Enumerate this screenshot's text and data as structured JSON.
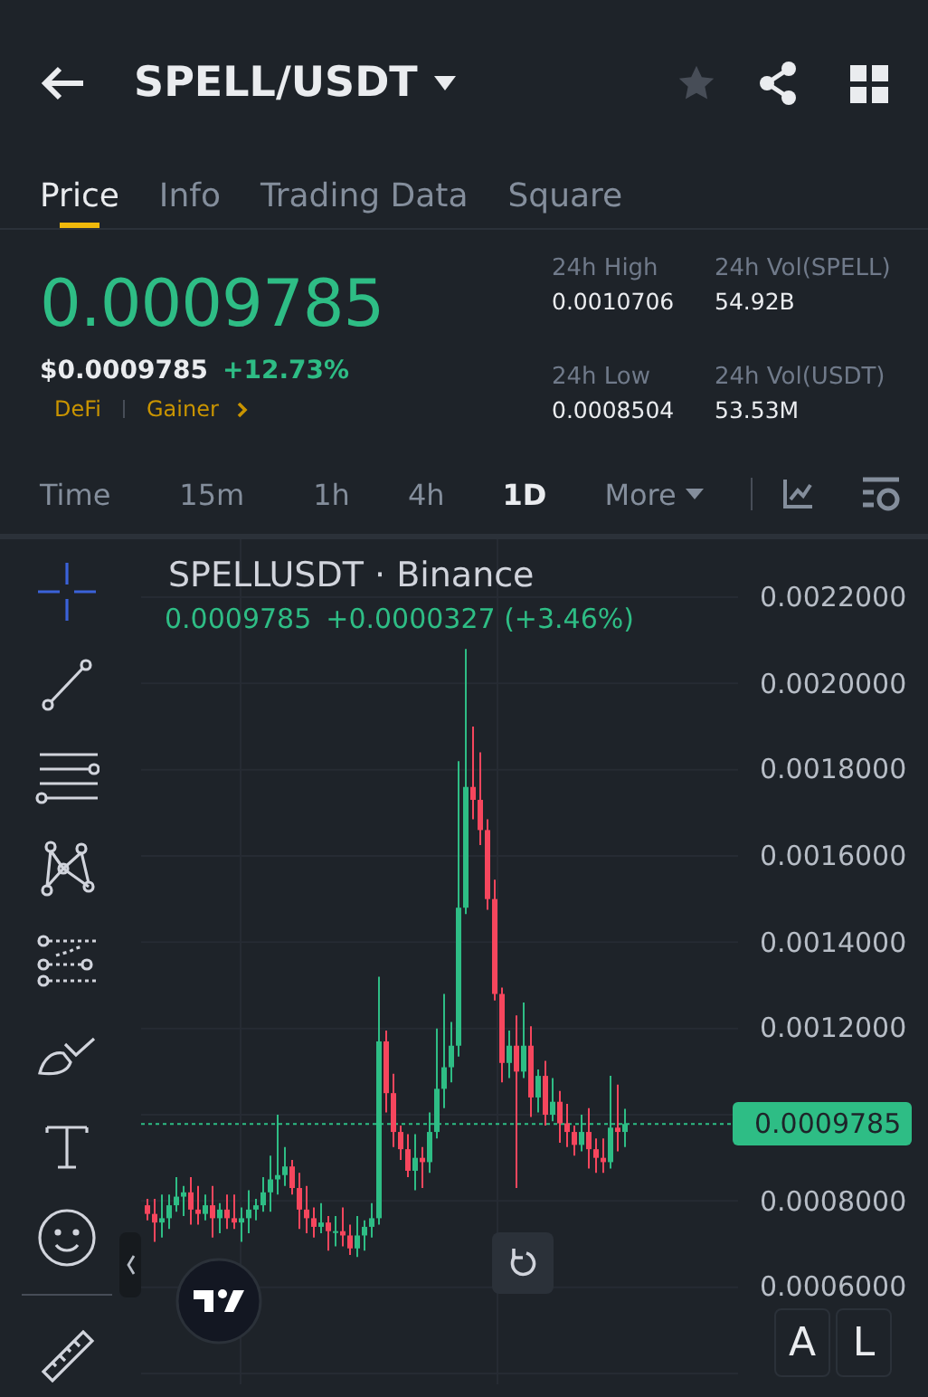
{
  "header": {
    "title": "SPELL/USDT",
    "favorite": false
  },
  "tabs": [
    {
      "label": "Price",
      "selected": true
    },
    {
      "label": "Info",
      "selected": false
    },
    {
      "label": "Trading Data",
      "selected": false
    },
    {
      "label": "Square",
      "selected": false
    }
  ],
  "price": {
    "last": "0.0009785",
    "fiat": "$0.0009785",
    "change": "+12.73%",
    "tags": [
      "DeFi",
      "Gainer"
    ]
  },
  "stats": [
    {
      "label": "24h High",
      "value": "0.0010706"
    },
    {
      "label": "24h Vol(SPELL)",
      "value": "54.92B"
    },
    {
      "label": "24h Low",
      "value": "0.0008504"
    },
    {
      "label": "24h Vol(USDT)",
      "value": "53.53M"
    }
  ],
  "intervals": [
    {
      "label": "Time",
      "selected": false,
      "kind": "plain"
    },
    {
      "label": "15m",
      "selected": false,
      "kind": "plain"
    },
    {
      "label": "1h",
      "selected": false,
      "kind": "plain"
    },
    {
      "label": "4h",
      "selected": false,
      "kind": "plain"
    },
    {
      "label": "1D",
      "selected": true,
      "kind": "plain"
    },
    {
      "label": "More",
      "selected": false,
      "kind": "menu"
    }
  ],
  "chart": {
    "symbol": "SPELLUSDT · Binance",
    "last": "0.0009785",
    "change": "+0.0000327 (+3.46%)",
    "buttons": [
      "A",
      "L"
    ],
    "chart_data": {
      "type": "candlestick",
      "ylim": [
        0.0004,
        0.0022
      ],
      "grid": true,
      "ref_lines": [
        {
          "axis": "y",
          "value": 0.0009785,
          "label": "0.0009785",
          "color": "#2ebd85"
        }
      ],
      "yticks": [
        {
          "value": 0.0022,
          "label": "0.0022000"
        },
        {
          "value": 0.002,
          "label": "0.0020000"
        },
        {
          "value": 0.0018,
          "label": "0.0018000"
        },
        {
          "value": 0.0016,
          "label": "0.0016000"
        },
        {
          "value": 0.0014,
          "label": "0.0014000"
        },
        {
          "value": 0.0012,
          "label": "0.0012000"
        },
        {
          "value": 0.0008,
          "label": "0.0008000"
        },
        {
          "value": 0.0006,
          "label": "0.0006000"
        }
      ],
      "ohlc": [
        [
          0.00079,
          0.000805,
          0.000755,
          0.00077
        ],
        [
          0.00077,
          0.000805,
          0.000705,
          0.00075
        ],
        [
          0.00075,
          0.000815,
          0.000715,
          0.00076
        ],
        [
          0.00076,
          0.000815,
          0.000735,
          0.00079
        ],
        [
          0.00079,
          0.000855,
          0.000775,
          0.00081
        ],
        [
          0.00081,
          0.000835,
          0.000765,
          0.00082
        ],
        [
          0.00082,
          0.000855,
          0.000745,
          0.00078
        ],
        [
          0.00078,
          0.000835,
          0.000745,
          0.00077
        ],
        [
          0.00077,
          0.000815,
          0.000755,
          0.00079
        ],
        [
          0.00079,
          0.000835,
          0.000715,
          0.00076
        ],
        [
          0.00076,
          0.000795,
          0.000725,
          0.00078
        ],
        [
          0.00078,
          0.000815,
          0.000735,
          0.00076
        ],
        [
          0.00076,
          0.000815,
          0.000735,
          0.00075
        ],
        [
          0.00075,
          0.000785,
          0.000705,
          0.00076
        ],
        [
          0.00076,
          0.000825,
          0.000725,
          0.00078
        ],
        [
          0.00078,
          0.000805,
          0.000755,
          0.00079
        ],
        [
          0.00079,
          0.000855,
          0.000775,
          0.00082
        ],
        [
          0.00082,
          0.000905,
          0.000775,
          0.00085
        ],
        [
          0.00085,
          0.001,
          0.000815,
          0.00086
        ],
        [
          0.00086,
          0.000925,
          0.000835,
          0.00088
        ],
        [
          0.00088,
          0.000895,
          0.000815,
          0.00083
        ],
        [
          0.00083,
          0.000865,
          0.000735,
          0.00078
        ],
        [
          0.00078,
          0.000835,
          0.000725,
          0.00076
        ],
        [
          0.00076,
          0.000785,
          0.000715,
          0.00074
        ],
        [
          0.00074,
          0.000795,
          0.000725,
          0.00075
        ],
        [
          0.00075,
          0.000765,
          0.000685,
          0.00073
        ],
        [
          0.00073,
          0.000765,
          0.000695,
          0.00073
        ],
        [
          0.00073,
          0.000785,
          0.000695,
          0.00072
        ],
        [
          0.00072,
          0.000745,
          0.000675,
          0.00069
        ],
        [
          0.00069,
          0.000765,
          0.00067,
          0.00072
        ],
        [
          0.00072,
          0.000755,
          0.000685,
          0.00074
        ],
        [
          0.00074,
          0.000795,
          0.000715,
          0.00076
        ],
        [
          0.00076,
          0.00132,
          0.000745,
          0.00117
        ],
        [
          0.00117,
          0.001195,
          0.001005,
          0.00105
        ],
        [
          0.00105,
          0.001095,
          0.000925,
          0.00096
        ],
        [
          0.00096,
          0.000975,
          0.000895,
          0.00092
        ],
        [
          0.00092,
          0.000955,
          0.000855,
          0.00087
        ],
        [
          0.00087,
          0.000955,
          0.000825,
          0.0009
        ],
        [
          0.0009,
          0.000925,
          0.00083,
          0.00089
        ],
        [
          0.00089,
          0.001005,
          0.000865,
          0.00096
        ],
        [
          0.00096,
          0.0012,
          0.000945,
          0.00106
        ],
        [
          0.00106,
          0.00128,
          0.001015,
          0.00111
        ],
        [
          0.00111,
          0.001215,
          0.001075,
          0.00116
        ],
        [
          0.00116,
          0.00182,
          0.001135,
          0.00148
        ],
        [
          0.00148,
          0.00208,
          0.001465,
          0.00176
        ],
        [
          0.00176,
          0.0019,
          0.001685,
          0.00173
        ],
        [
          0.00173,
          0.00184,
          0.001625,
          0.00166
        ],
        [
          0.00166,
          0.001685,
          0.001475,
          0.0015
        ],
        [
          0.0015,
          0.001545,
          0.001265,
          0.00128
        ],
        [
          0.00128,
          0.001295,
          0.001075,
          0.00112
        ],
        [
          0.00112,
          0.001195,
          0.001085,
          0.00116
        ],
        [
          0.00116,
          0.00123,
          0.00083,
          0.0011
        ],
        [
          0.0011,
          0.00126,
          0.001085,
          0.00116
        ],
        [
          0.00116,
          0.001205,
          0.000995,
          0.00104
        ],
        [
          0.00104,
          0.001105,
          0.001005,
          0.00109
        ],
        [
          0.00109,
          0.001125,
          0.000975,
          0.001
        ],
        [
          0.001,
          0.001085,
          0.000985,
          0.00103
        ],
        [
          0.00103,
          0.001055,
          0.000935,
          0.00098
        ],
        [
          0.00098,
          0.001025,
          0.000925,
          0.00096
        ],
        [
          0.00096,
          0.000975,
          0.000905,
          0.00093
        ],
        [
          0.00093,
          0.001,
          0.000915,
          0.00096
        ],
        [
          0.00096,
          0.001015,
          0.000875,
          0.00092
        ],
        [
          0.00092,
          0.000945,
          0.000865,
          0.0009
        ],
        [
          0.0009,
          0.000945,
          0.000865,
          0.00089
        ],
        [
          0.00089,
          0.00109,
          0.000875,
          0.00097
        ],
        [
          0.00097,
          0.00107,
          0.000915,
          0.00096
        ],
        [
          0.00096,
          0.0010135,
          0.000925,
          0.0009785
        ]
      ]
    }
  }
}
